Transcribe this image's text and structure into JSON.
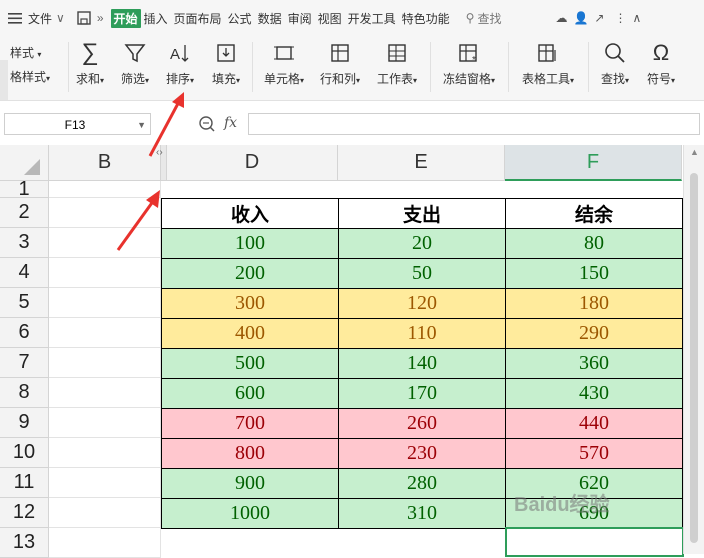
{
  "menubar": {
    "file_label": "文件",
    "start_label": "开始",
    "tabs": [
      "插入",
      "页面布局",
      "公式",
      "数据",
      "审阅",
      "视图",
      "开发工具",
      "特色功能"
    ],
    "search_label": "查找"
  },
  "ribbon": {
    "partial_style": "样式",
    "partial_format_style": "格样式",
    "sum": "求和",
    "filter": "筛选",
    "sort": "排序",
    "fill": "填充",
    "cell": "单元格",
    "rowcol": "行和列",
    "worksheet": "工作表",
    "freeze": "冻结窗格",
    "table_tools": "表格工具",
    "find": "查找",
    "symbol": "符号"
  },
  "formula_bar": {
    "name_box": "F13",
    "fx_label": "fx",
    "value": ""
  },
  "columns": [
    "B",
    "D",
    "E",
    "F"
  ],
  "rows": [
    "1",
    "2",
    "3",
    "4",
    "5",
    "6",
    "7",
    "8",
    "9",
    "10",
    "11",
    "12",
    "13"
  ],
  "table": {
    "headers": [
      "收入",
      "支出",
      "结余"
    ],
    "rows": [
      {
        "income": "100",
        "expense": "20",
        "balance": "80",
        "status": "green"
      },
      {
        "income": "200",
        "expense": "50",
        "balance": "150",
        "status": "green"
      },
      {
        "income": "300",
        "expense": "120",
        "balance": "180",
        "status": "yellow"
      },
      {
        "income": "400",
        "expense": "110",
        "balance": "290",
        "status": "yellow"
      },
      {
        "income": "500",
        "expense": "140",
        "balance": "360",
        "status": "green"
      },
      {
        "income": "600",
        "expense": "170",
        "balance": "430",
        "status": "green"
      },
      {
        "income": "700",
        "expense": "260",
        "balance": "440",
        "status": "red"
      },
      {
        "income": "800",
        "expense": "230",
        "balance": "570",
        "status": "red"
      },
      {
        "income": "900",
        "expense": "280",
        "balance": "620",
        "status": "green"
      },
      {
        "income": "1000",
        "expense": "310",
        "balance": "690",
        "status": "green"
      }
    ]
  },
  "colors": {
    "green_fill": "#c6efce",
    "green_text": "#006100",
    "yellow_fill": "#ffeb9c",
    "yellow_text": "#9c5700",
    "red_fill": "#ffc7ce",
    "red_text": "#9c0006",
    "accent": "#2e9d5a",
    "arrow": "#e8322d"
  },
  "watermark": "Baidu经验"
}
